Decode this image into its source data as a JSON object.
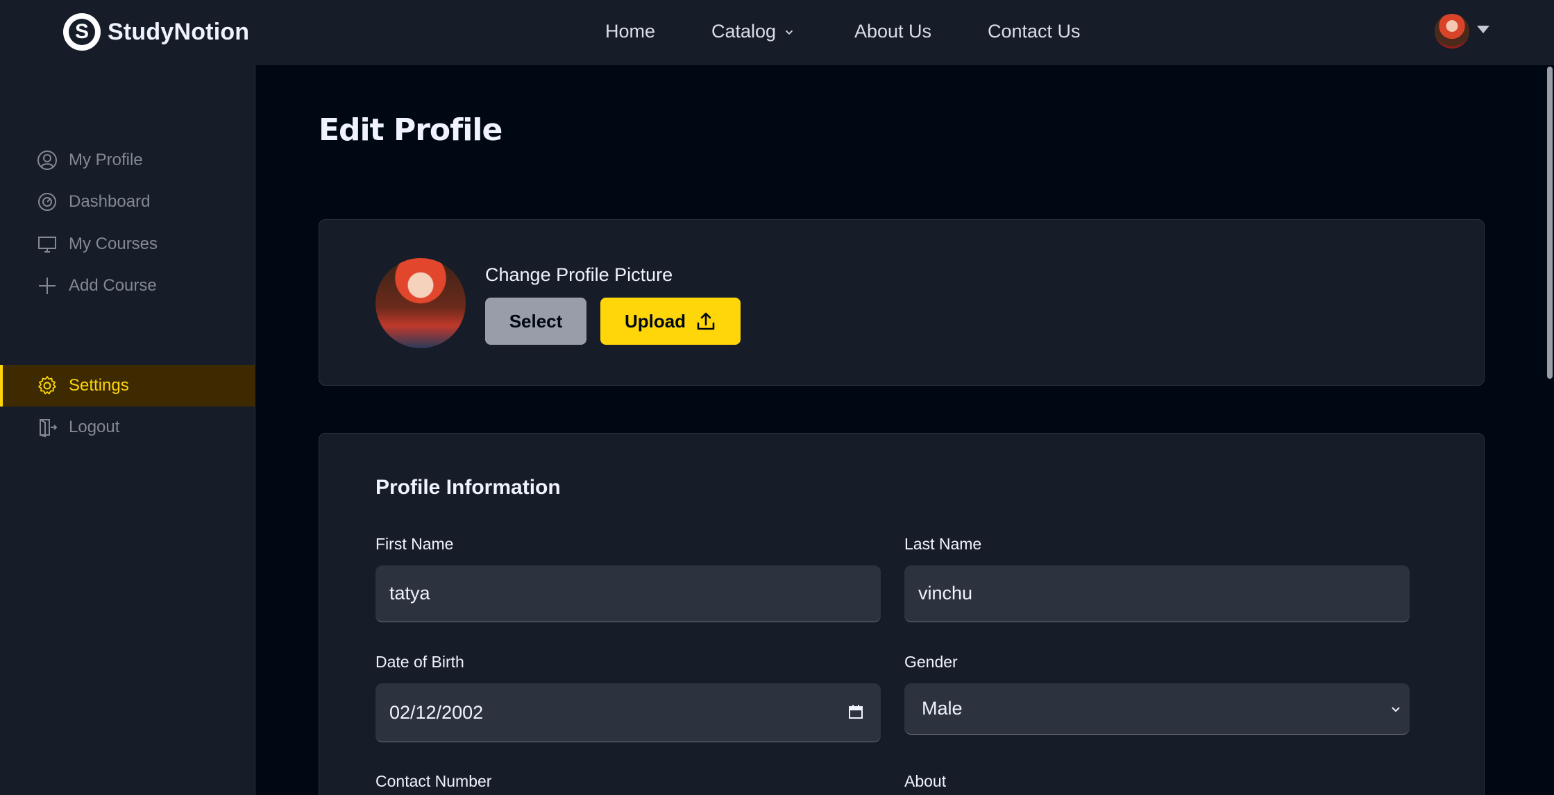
{
  "navbar": {
    "brand": "StudyNotion",
    "brand_letter": "S",
    "links": {
      "home": "Home",
      "catalog": "Catalog",
      "about": "About Us",
      "contact": "Contact Us"
    }
  },
  "sidebar": {
    "items": [
      {
        "label": "My Profile",
        "icon": "user-circle-icon"
      },
      {
        "label": "Dashboard",
        "icon": "gauge-icon"
      },
      {
        "label": "My Courses",
        "icon": "monitor-icon"
      },
      {
        "label": "Add Course",
        "icon": "plus-icon"
      }
    ],
    "settings": "Settings",
    "logout": "Logout"
  },
  "main": {
    "title": "Edit Profile",
    "picture": {
      "label": "Change Profile Picture",
      "select_label": "Select",
      "upload_label": "Upload"
    },
    "info": {
      "title": "Profile Information",
      "first_name_label": "First Name",
      "first_name_value": "tatya",
      "last_name_label": "Last Name",
      "last_name_value": "vinchu",
      "dob_label": "Date of Birth",
      "dob_value": "02/12/2002",
      "gender_label": "Gender",
      "gender_value": "Male",
      "contact_label": "Contact Number",
      "about_label": "About"
    }
  },
  "colors": {
    "page_bg": "#000814",
    "panel_bg": "#161D29",
    "field_bg": "#2C333F",
    "accent": "#FFD60A",
    "active_bg": "#3D2A01"
  }
}
